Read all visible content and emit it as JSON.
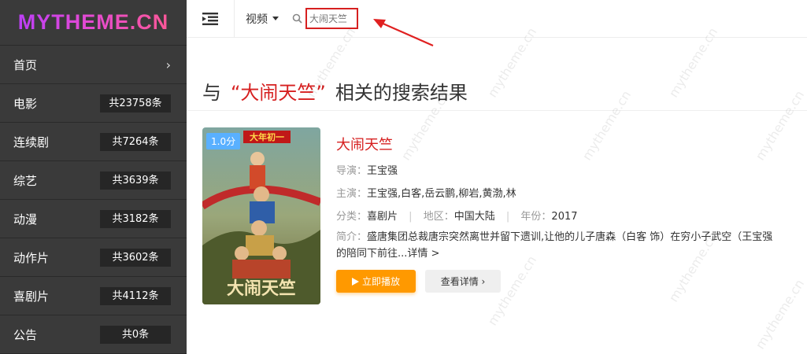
{
  "logo": "MYTHEME.CN",
  "sidebar": {
    "items": [
      {
        "label": "首页",
        "count": ""
      },
      {
        "label": "电影",
        "count": "共23758条"
      },
      {
        "label": "连续剧",
        "count": "共7264条"
      },
      {
        "label": "综艺",
        "count": "共3639条"
      },
      {
        "label": "动漫",
        "count": "共3182条"
      },
      {
        "label": "动作片",
        "count": "共3602条"
      },
      {
        "label": "喜剧片",
        "count": "共4112条"
      },
      {
        "label": "公告",
        "count": "共0条"
      }
    ]
  },
  "topbar": {
    "category": "视频",
    "search_value": "大闹天竺"
  },
  "heading": {
    "prefix": "与",
    "keyword": "“大闹天竺”",
    "suffix": "相关的搜索结果"
  },
  "result": {
    "score": "1.0分",
    "title": "大闹天竺",
    "director_label": "导演：",
    "director": "王宝强",
    "cast_label": "主演：",
    "cast": "王宝强,白客,岳云鹏,柳岩,黄渤,林",
    "genre_label": "分类：",
    "genre": "喜剧片",
    "region_label": "地区：",
    "region": "中国大陆",
    "year_label": "年份：",
    "year": "2017",
    "synopsis_label": "简介：",
    "synopsis_line1": "盛唐集团总裁唐宗突然离世并留下遗训,让他的儿子唐森（白客 饰）在穷小子武空（王宝强",
    "synopsis_line2": "的陪同下前往...详情 >",
    "play_label": "立即播放",
    "detail_label": "查看详情 ›",
    "poster_caption": "大年初一"
  },
  "watermark": "mytheme.cn",
  "colors": {
    "accent": "#d62020",
    "play": "#ff9900",
    "score": "#59b0ff",
    "sidebar": "#3a3a3a"
  }
}
